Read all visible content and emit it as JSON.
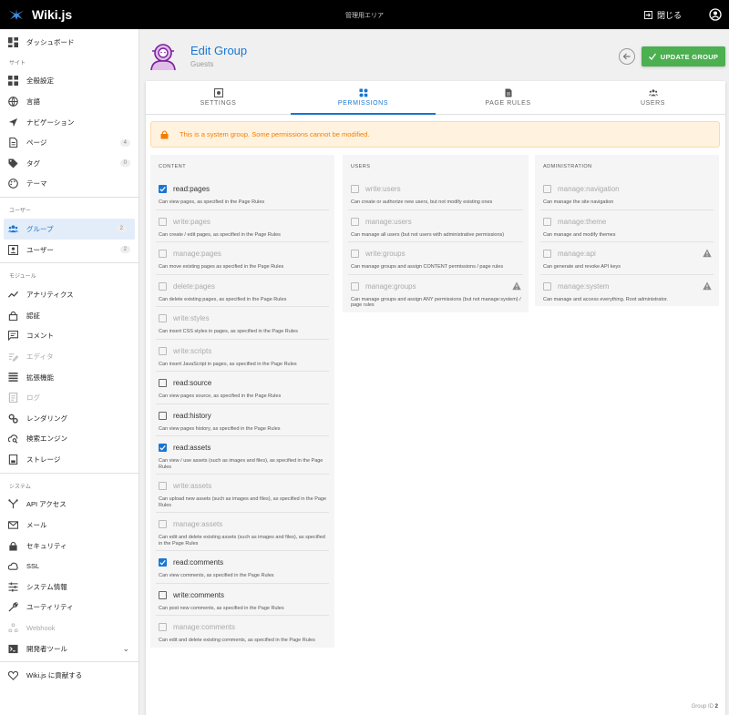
{
  "app": {
    "name": "Wiki.js",
    "area_label": "管理用エリア",
    "close_label": "閉じる"
  },
  "sidebar": {
    "dashboard": "ダッシュボード",
    "section_site": "サイト",
    "general": "全般設定",
    "locale": "言語",
    "navigation": "ナビゲーション",
    "pages": "ページ",
    "pages_count": "4",
    "tags": "タグ",
    "tags_count": "0",
    "theme": "テーマ",
    "section_users": "ユーザー",
    "groups": "グループ",
    "groups_count": "2",
    "users": "ユーザー",
    "users_count": "2",
    "section_modules": "モジュール",
    "analytics": "アナリティクス",
    "auth": "認証",
    "comments": "コメント",
    "editor": "エディタ",
    "extensions": "拡張機能",
    "logging": "ログ",
    "rendering": "レンダリング",
    "search": "検索エンジン",
    "storage": "ストレージ",
    "section_system": "システム",
    "api": "API アクセス",
    "mail": "メール",
    "security": "セキュリティ",
    "ssl": "SSL",
    "system_info": "システム情報",
    "utilities": "ユーティリティ",
    "webhook": "Webhook",
    "dev_tools": "開発者ツール",
    "contribute": "Wiki.js に貢献する"
  },
  "header": {
    "title": "Edit Group",
    "subtitle": "Guests",
    "update_label": "UPDATE GROUP"
  },
  "tabs": [
    {
      "label": "SETTINGS",
      "icon": "settings-icon"
    },
    {
      "label": "PERMISSIONS",
      "icon": "permissions-icon"
    },
    {
      "label": "PAGE RULES",
      "icon": "page-rules-icon"
    },
    {
      "label": "USERS",
      "icon": "users-icon"
    }
  ],
  "alert": "This is a system group. Some permissions cannot be modified.",
  "columns": {
    "content": {
      "title": "CONTENT",
      "perms": [
        {
          "name": "read:pages",
          "desc": "Can view pages, as specified in the Page Rules",
          "checked": true,
          "disabled": false
        },
        {
          "name": "write:pages",
          "desc": "Can create / edit pages, as specified in the Page Rules",
          "checked": false,
          "disabled": true
        },
        {
          "name": "manage:pages",
          "desc": "Can move existing pages as specified in the Page Rules",
          "checked": false,
          "disabled": true
        },
        {
          "name": "delete:pages",
          "desc": "Can delete existing pages, as specified in the Page Rules",
          "checked": false,
          "disabled": true
        },
        {
          "name": "write:styles",
          "desc": "Can insert CSS styles in pages, as specified in the Page Rules",
          "checked": false,
          "disabled": true
        },
        {
          "name": "write:scripts",
          "desc": "Can insert JavaScript in pages, as specified in the Page Rules",
          "checked": false,
          "disabled": true
        },
        {
          "name": "read:source",
          "desc": "Can view pages source, as specified in the Page Rules",
          "checked": false,
          "disabled": false
        },
        {
          "name": "read:history",
          "desc": "Can view pages history, as specified in the Page Rules",
          "checked": false,
          "disabled": false
        },
        {
          "name": "read:assets",
          "desc": "Can view / use assets (such as images and files), as specified in the Page Rules",
          "checked": true,
          "disabled": false
        },
        {
          "name": "write:assets",
          "desc": "Can upload new assets (such as images and files), as specified in the Page Rules",
          "checked": false,
          "disabled": true
        },
        {
          "name": "manage:assets",
          "desc": "Can edit and delete existing assets (such as images and files), as specified in the Page Rules",
          "checked": false,
          "disabled": true
        },
        {
          "name": "read:comments",
          "desc": "Can view comments, as specified in the Page Rules",
          "checked": true,
          "disabled": false
        },
        {
          "name": "write:comments",
          "desc": "Can post new comments, as specified in the Page Rules",
          "checked": false,
          "disabled": false
        },
        {
          "name": "manage:comments",
          "desc": "Can edit and delete existing comments, as specified in the Page Rules",
          "checked": false,
          "disabled": true
        }
      ]
    },
    "users": {
      "title": "USERS",
      "perms": [
        {
          "name": "write:users",
          "desc": "Can create or authorize new users, but not modify existing ones",
          "checked": false,
          "disabled": true,
          "warn": false
        },
        {
          "name": "manage:users",
          "desc": "Can manage all users (but not users with administrative permissions)",
          "checked": false,
          "disabled": true,
          "warn": false
        },
        {
          "name": "write:groups",
          "desc": "Can manage groups and assign CONTENT permissions / page rules",
          "checked": false,
          "disabled": true,
          "warn": false
        },
        {
          "name": "manage:groups",
          "desc": "Can manage groups and assign ANY permissions (but not manage:system) / page rules",
          "checked": false,
          "disabled": true,
          "warn": true
        }
      ]
    },
    "admin": {
      "title": "ADMINISTRATION",
      "perms": [
        {
          "name": "manage:navigation",
          "desc": "Can manage the site navigation",
          "checked": false,
          "disabled": true,
          "warn": false
        },
        {
          "name": "manage:theme",
          "desc": "Can manage and modify themes",
          "checked": false,
          "disabled": true,
          "warn": false
        },
        {
          "name": "manage:api",
          "desc": "Can generate and revoke API keys",
          "checked": false,
          "disabled": true,
          "warn": true
        },
        {
          "name": "manage:system",
          "desc": "Can manage and access everything. Root administrator.",
          "checked": false,
          "disabled": true,
          "warn": true
        }
      ]
    }
  },
  "footer": {
    "label": "Group ID",
    "value": "2"
  },
  "colors": {
    "accent": "#1976d2",
    "success": "#4caf50",
    "warning": "#f57c00"
  }
}
